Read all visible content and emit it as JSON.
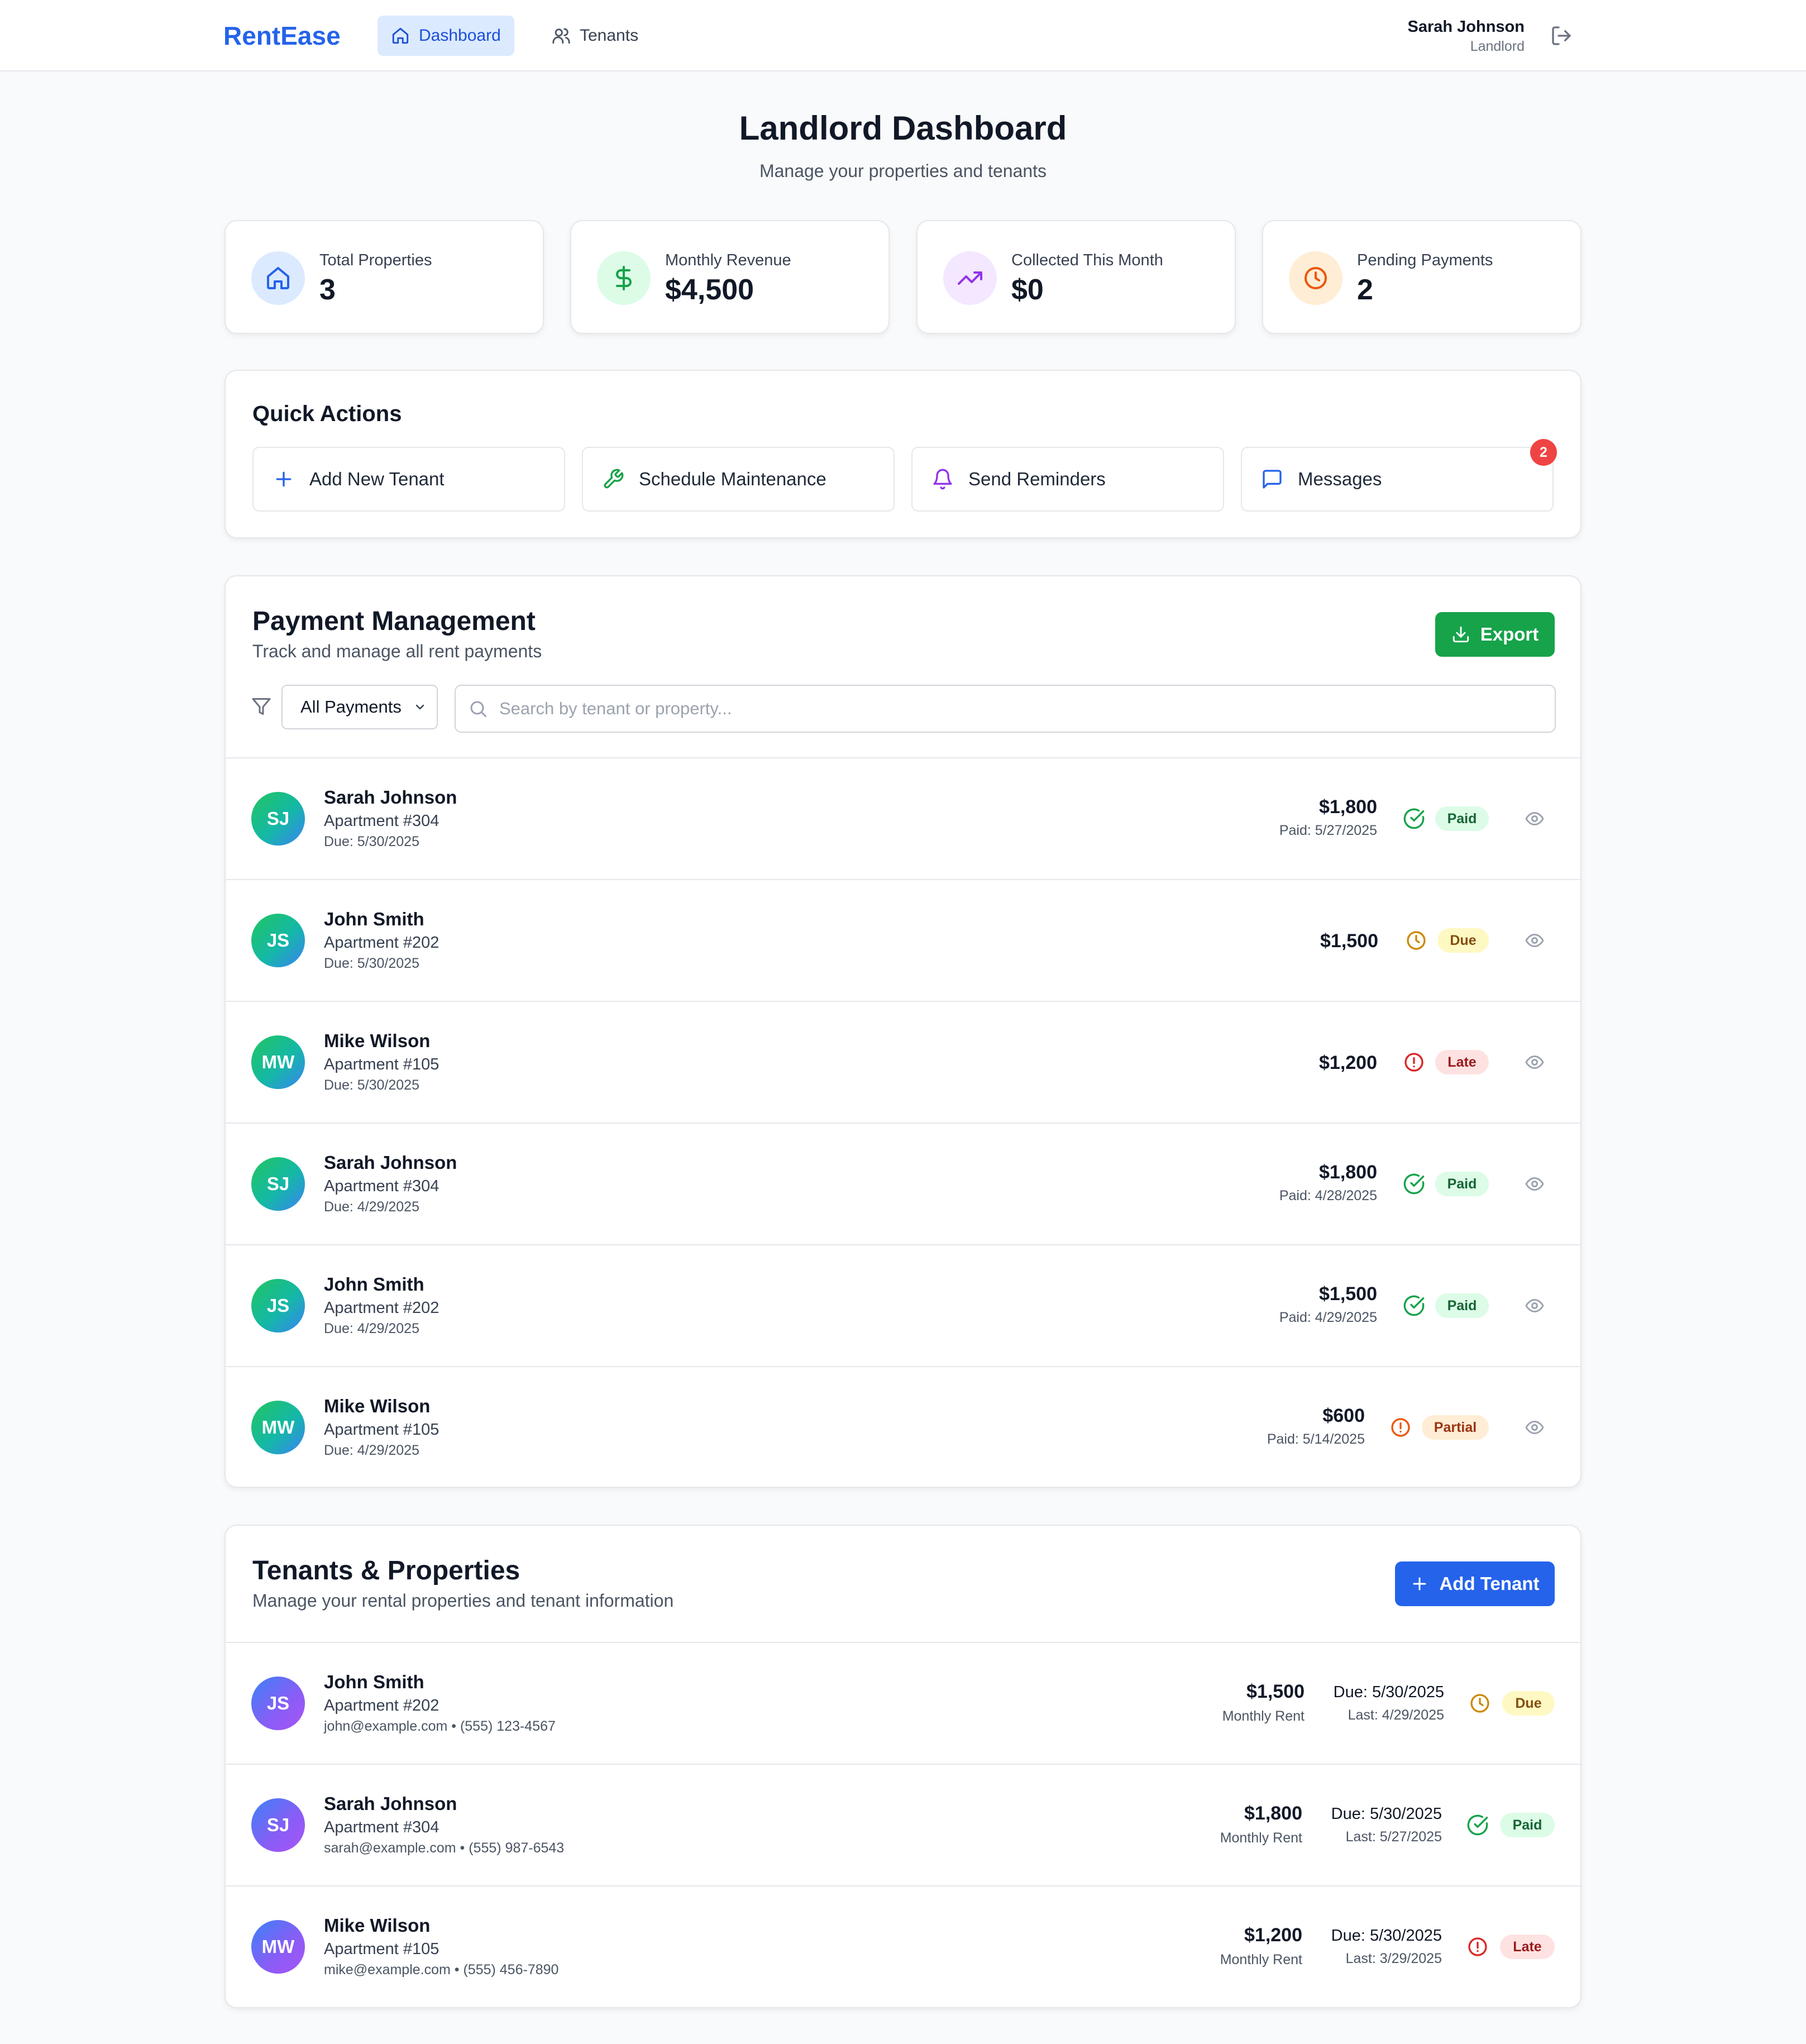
{
  "app": {
    "brand": "RentEase",
    "nav": [
      {
        "label": "Dashboard",
        "icon": "home-icon",
        "active": true
      },
      {
        "label": "Tenants",
        "icon": "users-icon",
        "active": false
      }
    ],
    "user": {
      "name": "Sarah Johnson",
      "role": "Landlord"
    }
  },
  "page": {
    "title": "Landlord Dashboard",
    "subtitle": "Manage your properties and tenants"
  },
  "stats": [
    {
      "label": "Total Properties",
      "value": "3",
      "icon": "home-icon",
      "color": "#2563eb"
    },
    {
      "label": "Monthly Revenue",
      "value": "$4,500",
      "icon": "dollar-icon",
      "color": "#16a34a"
    },
    {
      "label": "Collected This Month",
      "value": "$0",
      "icon": "trending-up-icon",
      "color": "#9333ea"
    },
    {
      "label": "Pending Payments",
      "value": "2",
      "icon": "clock-icon",
      "color": "#ea580c"
    }
  ],
  "quick_actions": {
    "title": "Quick Actions",
    "items": [
      {
        "label": "Add New Tenant",
        "icon": "plus-icon"
      },
      {
        "label": "Schedule Maintenance",
        "icon": "wrench-icon"
      },
      {
        "label": "Send Reminders",
        "icon": "bell-icon"
      },
      {
        "label": "Messages",
        "icon": "message-icon",
        "badge": "2"
      }
    ]
  },
  "payments": {
    "title": "Payment Management",
    "subtitle": "Track and manage all rent payments",
    "export_label": "Export",
    "filter_value": "All Payments",
    "search_placeholder": "Search by tenant or property...",
    "rows": [
      {
        "initials": "SJ",
        "name": "Sarah Johnson",
        "apartment": "Apartment #304",
        "due": "Due: 5/30/2025",
        "amount": "$1,800",
        "paid": "Paid: 5/27/2025",
        "status": "Paid"
      },
      {
        "initials": "JS",
        "name": "John Smith",
        "apartment": "Apartment #202",
        "due": "Due: 5/30/2025",
        "amount": "$1,500",
        "paid": "",
        "status": "Due"
      },
      {
        "initials": "MW",
        "name": "Mike Wilson",
        "apartment": "Apartment #105",
        "due": "Due: 5/30/2025",
        "amount": "$1,200",
        "paid": "",
        "status": "Late"
      },
      {
        "initials": "SJ",
        "name": "Sarah Johnson",
        "apartment": "Apartment #304",
        "due": "Due: 4/29/2025",
        "amount": "$1,800",
        "paid": "Paid: 4/28/2025",
        "status": "Paid"
      },
      {
        "initials": "JS",
        "name": "John Smith",
        "apartment": "Apartment #202",
        "due": "Due: 4/29/2025",
        "amount": "$1,500",
        "paid": "Paid: 4/29/2025",
        "status": "Paid"
      },
      {
        "initials": "MW",
        "name": "Mike Wilson",
        "apartment": "Apartment #105",
        "due": "Due: 4/29/2025",
        "amount": "$600",
        "paid": "Paid: 5/14/2025",
        "status": "Partial"
      }
    ]
  },
  "tenants": {
    "title": "Tenants & Properties",
    "subtitle": "Manage your rental properties and tenant information",
    "add_label": "Add Tenant",
    "rows": [
      {
        "initials": "JS",
        "name": "John Smith",
        "apartment": "Apartment #202",
        "contact": "john@example.com • (555) 123-4567",
        "rent": "$1,500",
        "rent_label": "Monthly Rent",
        "due": "Due: 5/30/2025",
        "last": "Last: 4/29/2025",
        "status": "Due"
      },
      {
        "initials": "SJ",
        "name": "Sarah Johnson",
        "apartment": "Apartment #304",
        "contact": "sarah@example.com • (555) 987-6543",
        "rent": "$1,800",
        "rent_label": "Monthly Rent",
        "due": "Due: 5/30/2025",
        "last": "Last: 5/27/2025",
        "status": "Paid"
      },
      {
        "initials": "MW",
        "name": "Mike Wilson",
        "apartment": "Apartment #105",
        "contact": "mike@example.com • (555) 456-7890",
        "rent": "$1,200",
        "rent_label": "Monthly Rent",
        "due": "Due: 5/30/2025",
        "last": "Last: 3/29/2025",
        "status": "Late"
      }
    ]
  },
  "colors": {
    "primary": "#2563eb",
    "export": "#16a34a",
    "paid": "#16a34a",
    "due": "#ca8a04",
    "late": "#dc2626",
    "partial": "#ea580c"
  }
}
